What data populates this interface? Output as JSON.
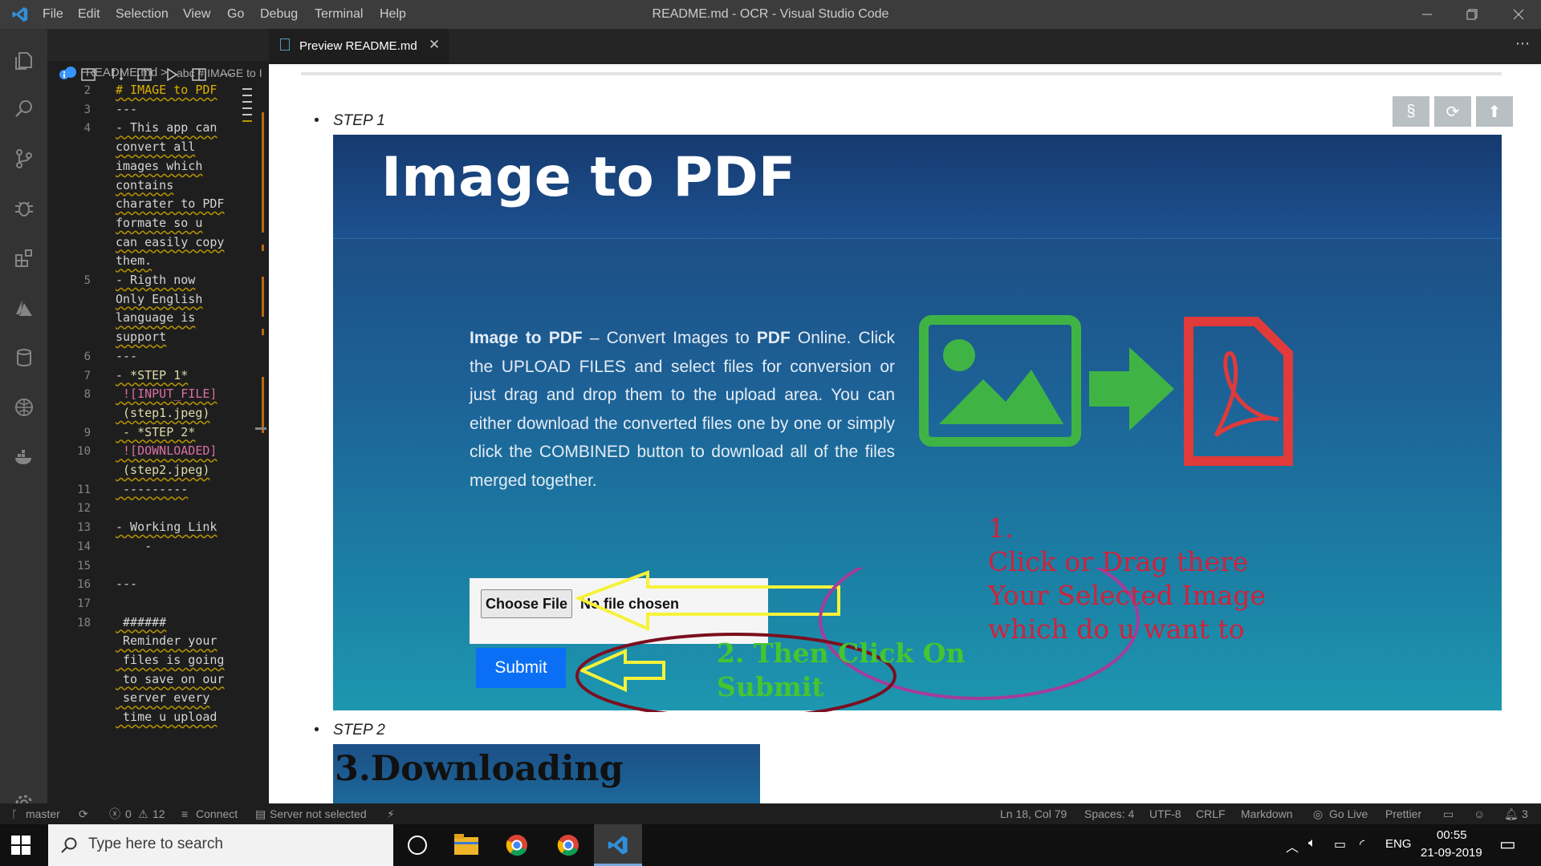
{
  "window": {
    "title": "README.md - OCR - Visual Studio Code",
    "menu": [
      "File",
      "Edit",
      "Selection",
      "View",
      "Go",
      "Debug",
      "Terminal",
      "Help"
    ]
  },
  "breadcrumb": {
    "file": "README.md",
    "separator": ">",
    "symbol": "abc # IMAGE to I"
  },
  "editor": {
    "lines": [
      {
        "num": "2",
        "text": "# IMAGE to PDF"
      },
      {
        "num": "3",
        "text": "---"
      },
      {
        "num": "4",
        "text": "- This app can"
      },
      {
        "num": "",
        "text": "convert all"
      },
      {
        "num": "",
        "text": "images which"
      },
      {
        "num": "",
        "text": "contains"
      },
      {
        "num": "",
        "text": "charater to PDF"
      },
      {
        "num": "",
        "text": "formate so u"
      },
      {
        "num": "",
        "text": "can easily copy"
      },
      {
        "num": "",
        "text": "them."
      },
      {
        "num": "5",
        "text": "- Rigth now"
      },
      {
        "num": "",
        "text": "Only English"
      },
      {
        "num": "",
        "text": "language is"
      },
      {
        "num": "",
        "text": "support"
      },
      {
        "num": "6",
        "text": "---"
      },
      {
        "num": "7",
        "text": "- *STEP 1*"
      },
      {
        "num": "8",
        "text": " ![INPUT_FILE]"
      },
      {
        "num": "",
        "text": " (step1.jpeg)"
      },
      {
        "num": "9",
        "text": " - *STEP 2*"
      },
      {
        "num": "10",
        "text": " ![DOWNLOADED]"
      },
      {
        "num": "",
        "text": " (step2.jpeg)"
      },
      {
        "num": "11",
        "text": " ---------"
      },
      {
        "num": "12",
        "text": ""
      },
      {
        "num": "13",
        "text": "- Working Link"
      },
      {
        "num": "14",
        "text": "    -"
      },
      {
        "num": "15",
        "text": ""
      },
      {
        "num": "16",
        "text": "---"
      },
      {
        "num": "17",
        "text": ""
      },
      {
        "num": "18",
        "text": " ######"
      },
      {
        "num": "",
        "text": " Reminder your"
      },
      {
        "num": "",
        "text": " files is going"
      },
      {
        "num": "",
        "text": " to save on our"
      },
      {
        "num": "",
        "text": " server every"
      },
      {
        "num": "",
        "text": " time u upload"
      }
    ]
  },
  "preview_tab": {
    "label": "Preview README.md"
  },
  "preview": {
    "buttons": [
      "§",
      "⟳",
      "⬆"
    ],
    "step1_label": "STEP 1",
    "step2_label": "STEP 2",
    "step1_image": {
      "heading": "Image to PDF",
      "description_bold1": "Image to PDF",
      "description_part1": " – Convert Images to ",
      "description_bold2": "PDF",
      "description_part2": " Online. Click the UPLOAD FILES and select files for conversion or just drag and drop them to the upload area. You can either download the converted files one by one or simply click the COMBINED button to download all of the files merged together.",
      "choose_file": "Choose File",
      "no_file": "No file chosen",
      "submit": "Submit",
      "annotation1": "1.\nClick or Drag there\nYour Selected Image\nwhich do u want to",
      "annotation2": "2. Then Click On\nSubmit"
    },
    "step2_image": {
      "heading": "3.Downloading"
    }
  },
  "status": {
    "branch": "master",
    "errors": "0",
    "warnings": "12",
    "connect": "Connect",
    "server": "Server not selected",
    "position": "Ln 18, Col 79",
    "spaces": "Spaces: 4",
    "encoding": "UTF-8",
    "eol": "CRLF",
    "language": "Markdown",
    "golive": "Go Live",
    "prettier": "Prettier",
    "notifications": "3"
  },
  "taskbar": {
    "search_placeholder": "Type here to search",
    "lang": "ENG",
    "time": "00:55",
    "date": "21-09-2019"
  },
  "colors": {
    "accent": "#007acc",
    "warning_wave": "#b89500"
  }
}
